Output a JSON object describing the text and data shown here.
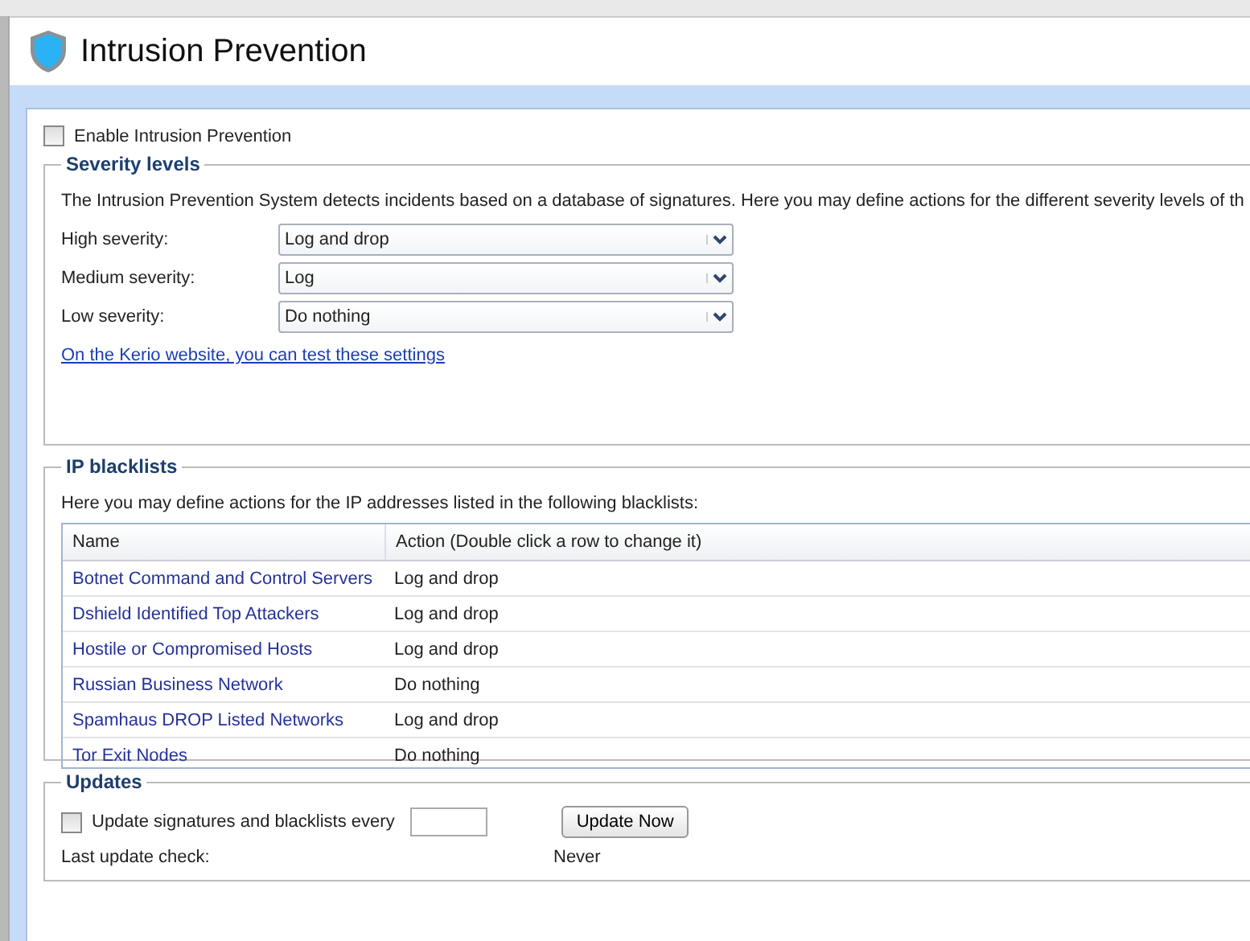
{
  "header": {
    "title": "Intrusion Prevention"
  },
  "enable": {
    "label": "Enable Intrusion Prevention",
    "checked": false
  },
  "severity": {
    "legend": "Severity levels",
    "description": "The Intrusion Prevention System detects incidents based on a database of signatures. Here you may define actions for the different severity levels of th",
    "rows": [
      {
        "label": "High severity:",
        "value": "Log and drop"
      },
      {
        "label": "Medium severity:",
        "value": "Log"
      },
      {
        "label": "Low severity:",
        "value": "Do nothing"
      }
    ],
    "link": "On the Kerio website, you can test these settings"
  },
  "blacklists": {
    "legend": "IP blacklists",
    "description": "Here you may define actions for the IP addresses listed in the following blacklists:",
    "columns": [
      "Name",
      "Action (Double click a row to change it)"
    ],
    "rows": [
      {
        "name": "Botnet Command and Control Servers",
        "action": "Log and drop"
      },
      {
        "name": "Dshield Identified Top Attackers",
        "action": "Log and drop"
      },
      {
        "name": "Hostile or Compromised Hosts",
        "action": "Log and drop"
      },
      {
        "name": "Russian Business Network",
        "action": "Do nothing"
      },
      {
        "name": "Spamhaus DROP Listed Networks",
        "action": "Log and drop"
      },
      {
        "name": "Tor Exit Nodes",
        "action": "Do nothing"
      }
    ]
  },
  "updates": {
    "legend": "Updates",
    "auto": {
      "label": "Update signatures and blacklists every",
      "checked": false
    },
    "button": "Update Now",
    "last_check": {
      "label": "Last update check:",
      "value": "Never"
    }
  }
}
